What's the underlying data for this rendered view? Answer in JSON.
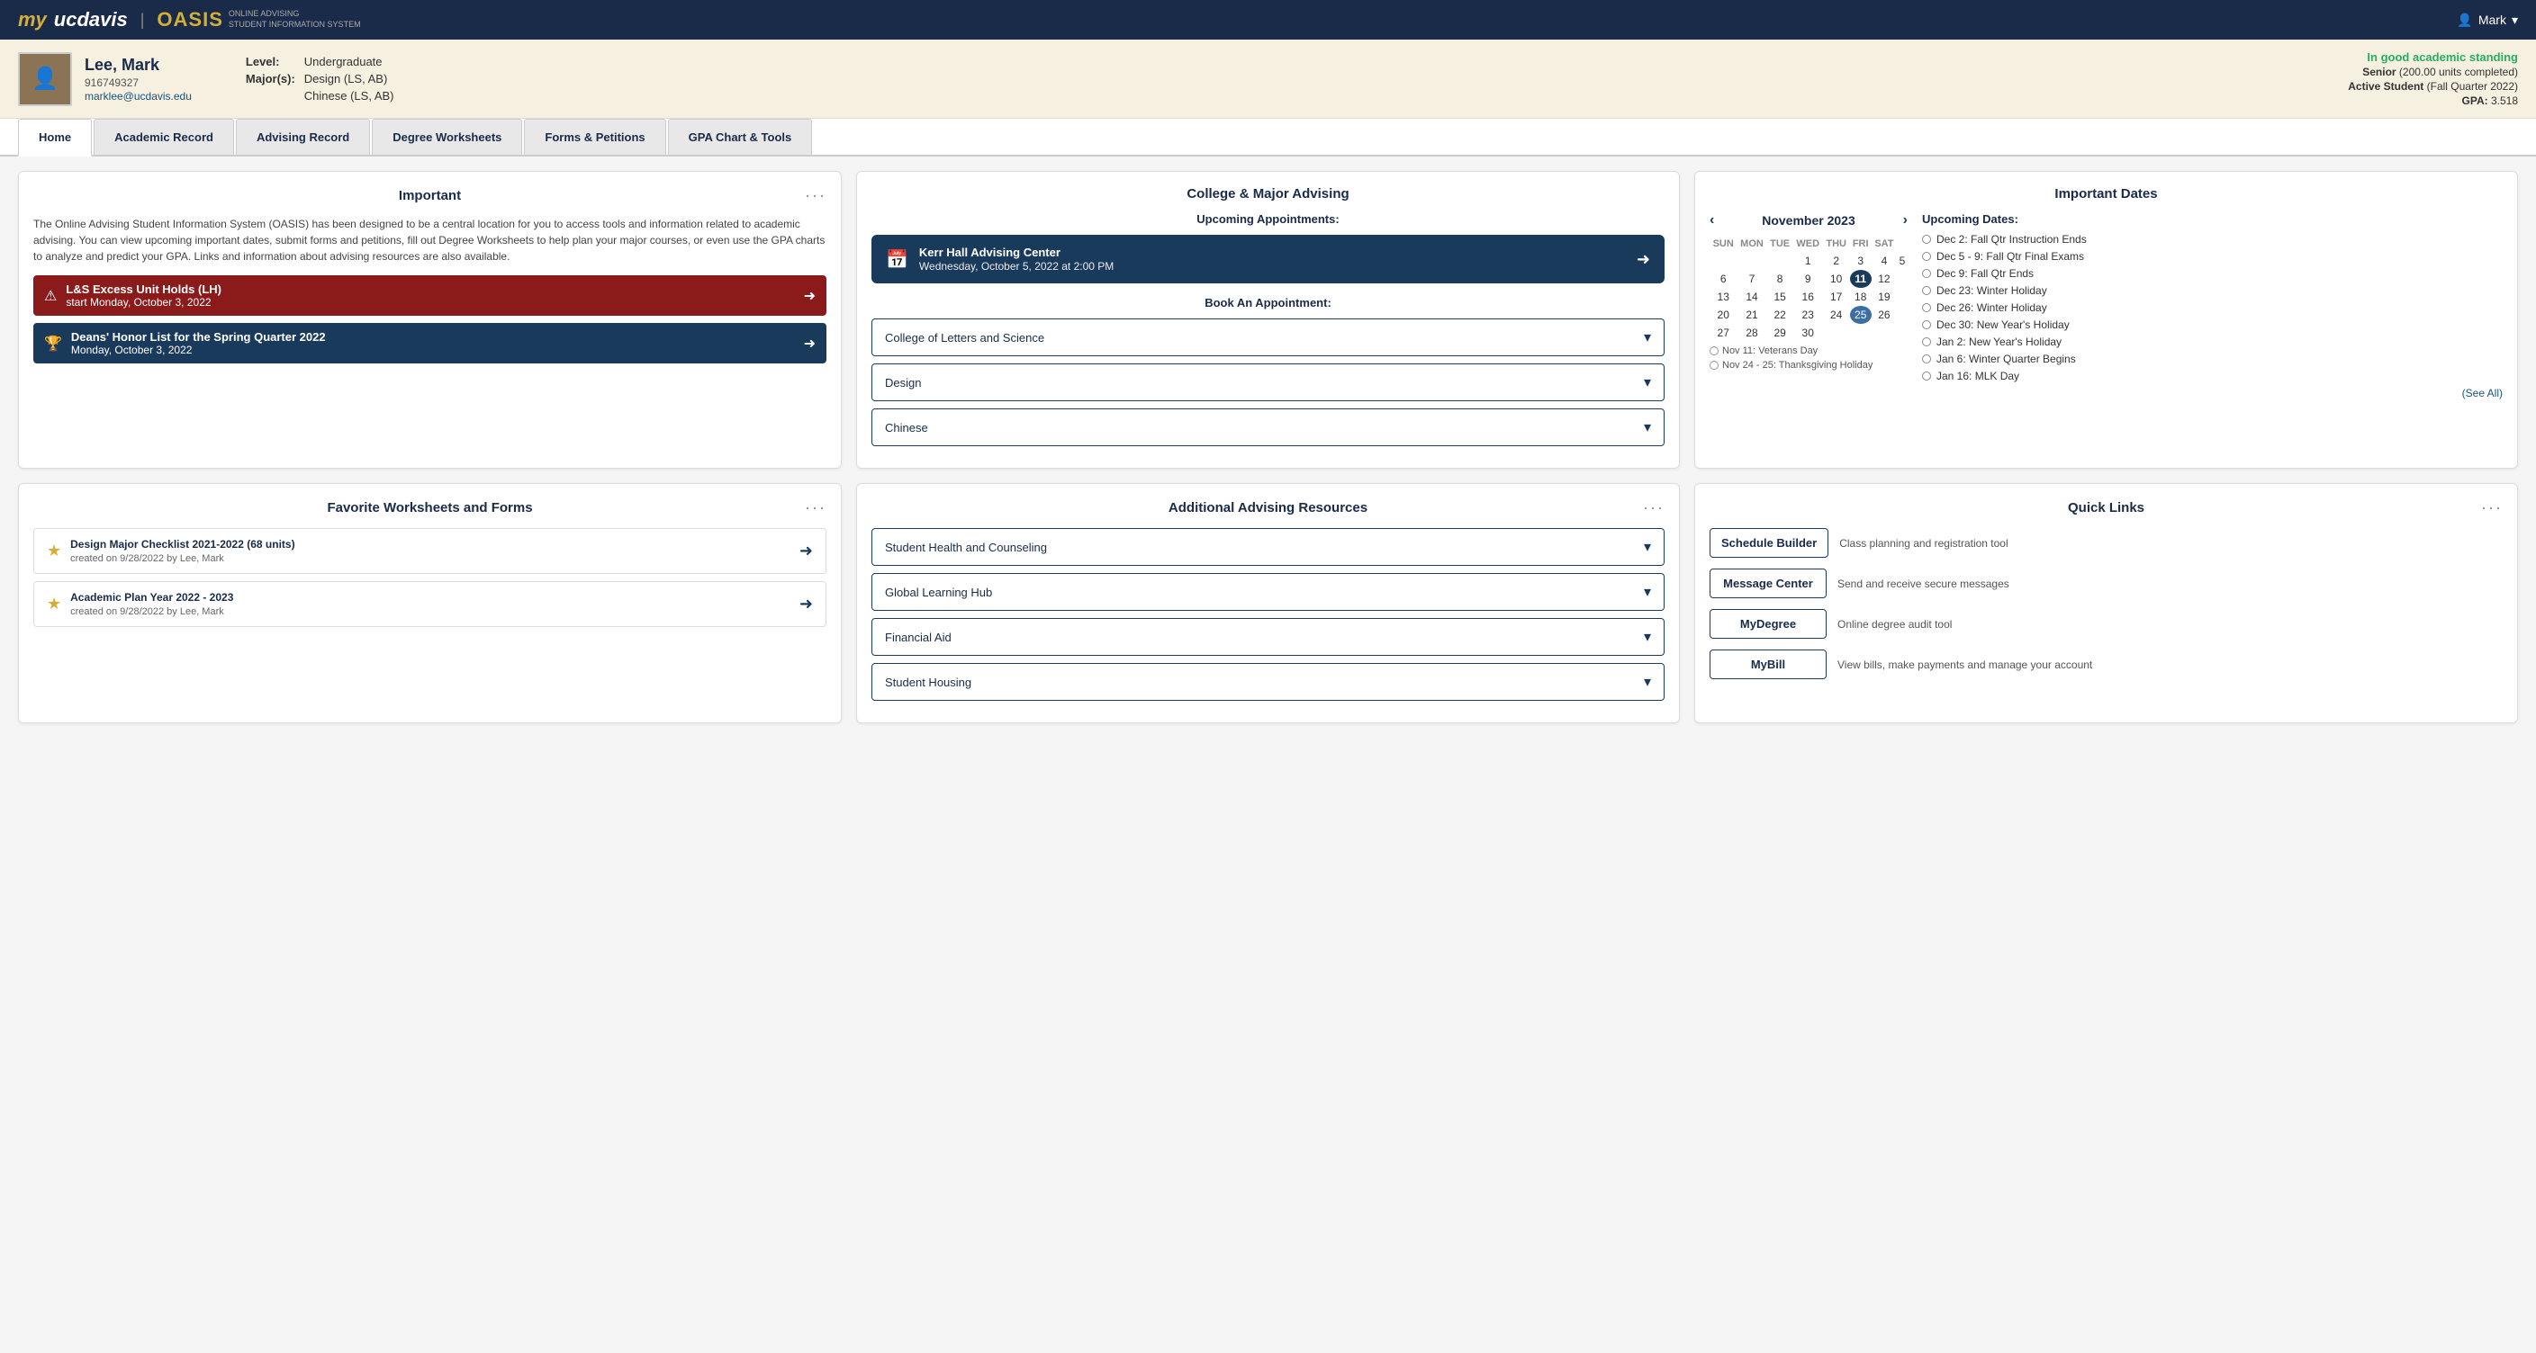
{
  "topbar": {
    "logo_my": "my",
    "logo_ucdavis": "ucdavis",
    "logo_divider": "|",
    "logo_oasis": "OASIS",
    "logo_subtitle_line1": "Online Advising",
    "logo_subtitle_line2": "Student Information System",
    "user_label": "Mark"
  },
  "profile": {
    "name": "Lee, Mark",
    "student_id": "916749327",
    "email": "marklee@ucdavis.edu",
    "level_label": "Level:",
    "level_value": "Undergraduate",
    "major_label": "Major(s):",
    "major_value1": "Design (LS, AB)",
    "major_value2": "Chinese (LS, AB)",
    "standing": "In good academic standing",
    "year": "Senior",
    "units": "(200.00 units completed)",
    "active_label": "Active Student",
    "active_term": "(Fall Quarter 2022)",
    "gpa_label": "GPA:",
    "gpa_value": "3.518"
  },
  "tabs": {
    "home": "Home",
    "academic_record": "Academic Record",
    "advising_record": "Advising Record",
    "degree_worksheets": "Degree Worksheets",
    "forms_petitions": "Forms & Petitions",
    "gpa_chart": "GPA Chart & Tools"
  },
  "important": {
    "title": "Important",
    "desc": "The Online Advising Student Information System (OASIS) has been designed to be a central location for you to access tools and information related to academic advising. You can view upcoming important dates, submit forms and petitions, fill out Degree Worksheets to help plan your major courses, or even use the GPA charts to analyze and predict your GPA. Links and information about advising resources are also available.",
    "alert_title": "L&S Excess Unit Holds (LH)",
    "alert_subtitle": "start Monday, October 3, 2022",
    "honor_title": "Deans' Honor List for the Spring Quarter 2022",
    "honor_subtitle": "Monday, October 3, 2022"
  },
  "advising": {
    "title": "College & Major Advising",
    "upcoming_label": "Upcoming Appointments:",
    "appointment_location": "Kerr Hall Advising Center",
    "appointment_time": "Wednesday, October 5, 2022 at 2:00 PM",
    "book_label": "Book An Appointment:",
    "dropdown1": "College of Letters and Science",
    "dropdown2": "Design",
    "dropdown3": "Chinese"
  },
  "important_dates": {
    "title": "Important Dates",
    "calendar_month": "November 2023",
    "days_header": [
      "SUN",
      "MON",
      "TUE",
      "WED",
      "THU",
      "FRI",
      "SAT"
    ],
    "weeks": [
      [
        "",
        "",
        "",
        "1",
        "2",
        "3",
        "4",
        "5"
      ],
      [
        "6",
        "7",
        "8",
        "9",
        "10",
        "11",
        "12"
      ],
      [
        "13",
        "14",
        "15",
        "16",
        "17",
        "18",
        "19"
      ],
      [
        "20",
        "21",
        "22",
        "23",
        "24",
        "25",
        "26"
      ],
      [
        "27",
        "28",
        "29",
        "30",
        "",
        "",
        ""
      ]
    ],
    "today": "11",
    "highlighted": "25",
    "holidays": [
      "Nov 11: Veterans Day",
      "Nov 24 - 25: Thanksgiving Holiday"
    ],
    "upcoming_dates_title": "Upcoming Dates:",
    "upcoming_dates": [
      "Dec 2: Fall Qtr Instruction Ends",
      "Dec 5 - 9: Fall Qtr Final Exams",
      "Dec 9: Fall Qtr Ends",
      "Dec 23: Winter Holiday",
      "Dec 26: Winter Holiday",
      "Dec 30: New Year's Holiday",
      "Jan 2: New Year's Holiday",
      "Jan 6: Winter Quarter Begins",
      "Jan 16: MLK Day"
    ],
    "see_all": "(See All)"
  },
  "favorites": {
    "title": "Favorite Worksheets and Forms",
    "item1_title": "Design Major Checklist 2021-2022 (68 units)",
    "item1_sub": "created on 9/28/2022 by Lee, Mark",
    "item2_title": "Academic Plan Year 2022 - 2023",
    "item2_sub": "created on 9/28/2022 by Lee, Mark"
  },
  "resources": {
    "title": "Additional Advising Resources",
    "dropdown1": "Student Health and Counseling",
    "dropdown2": "Global Learning Hub",
    "dropdown3": "Financial Aid",
    "dropdown4": "Student Housing"
  },
  "quicklinks": {
    "title": "Quick Links",
    "link1_label": "Schedule Builder",
    "link1_desc": "Class planning and registration tool",
    "link2_label": "Message Center",
    "link2_desc": "Send and receive secure messages",
    "link3_label": "MyDegree",
    "link3_desc": "Online degree audit tool",
    "link4_label": "MyBill",
    "link4_desc": "View bills, make payments and manage your account"
  }
}
